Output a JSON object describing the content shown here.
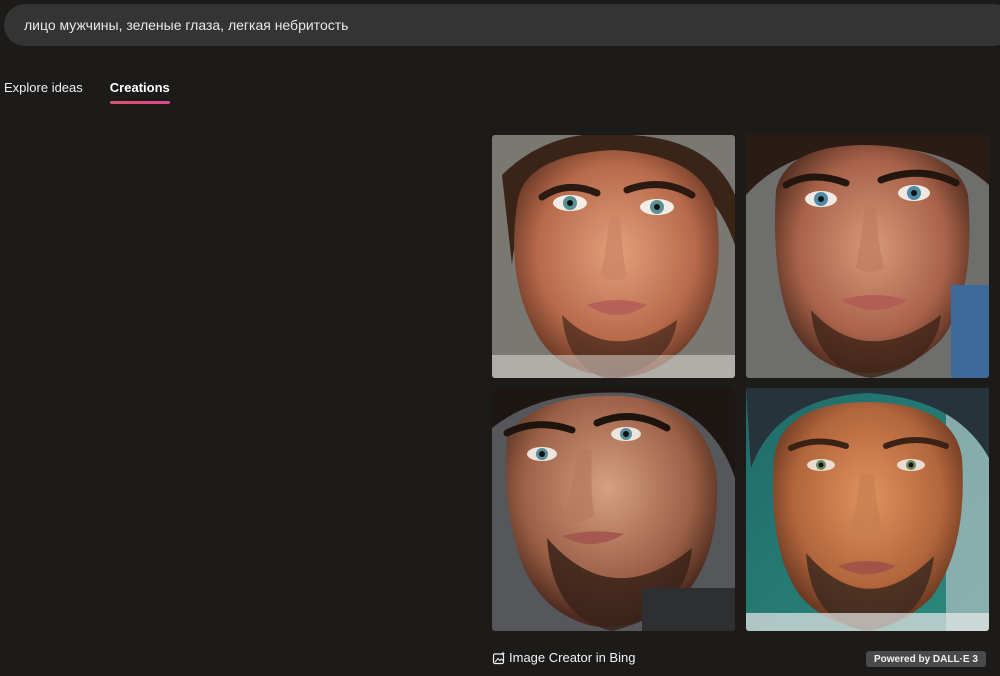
{
  "search": {
    "value": "лицо мужчины, зеленые глаза, легкая небритость"
  },
  "tabs": [
    {
      "label": "Explore ideas",
      "active": false
    },
    {
      "label": "Creations",
      "active": true
    }
  ],
  "colors": {
    "background": "#1c1b1a",
    "search_bg": "#343434",
    "tab_underline": "#e0516e",
    "badge_bg": "#4a4a4a"
  },
  "images": [
    {
      "subject": "man-face-portrait",
      "background_tone": "gray",
      "hair": "dark-tousled"
    },
    {
      "subject": "man-face-portrait",
      "background_tone": "gray-blue",
      "hair": "dark"
    },
    {
      "subject": "man-face-portrait",
      "background_tone": "dark-gray",
      "hair": "dark"
    },
    {
      "subject": "man-face-portrait",
      "background_tone": "teal",
      "hair": "dark"
    }
  ],
  "footer": {
    "icon": "image-create-icon",
    "creator_label": "Image Creator in Bing",
    "badge_label": "Powered by DALL·E 3"
  }
}
